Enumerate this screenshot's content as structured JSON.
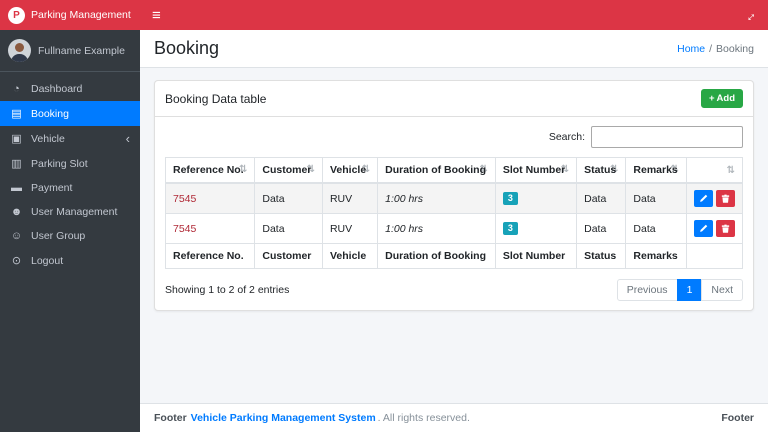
{
  "colors": {
    "red": "#dc3545",
    "sidebar_dark": "#343a40",
    "active_blue": "#007bff",
    "green": "#28a745",
    "teal_badge": "#17a2b8",
    "ref_red": "#b02a37"
  },
  "brand": {
    "title": "Parking Management",
    "logo_letter": "P"
  },
  "topbar": {
    "menu_icon": "≡",
    "fullscreen_icon": "↔"
  },
  "sidebar": {
    "user_name": "Fullname Example",
    "items": [
      {
        "label": "Dashboard",
        "icon": "◔"
      },
      {
        "label": "Booking",
        "icon": "▤"
      },
      {
        "label": "Vehicle",
        "icon": "▣",
        "chevron": "‹"
      },
      {
        "label": "Parking Slot",
        "icon": "▥"
      },
      {
        "label": "Payment",
        "icon": "▬"
      },
      {
        "label": "User Management",
        "icon": "☻"
      },
      {
        "label": "User Group",
        "icon": "☺"
      },
      {
        "label": "Logout",
        "icon": "⊙"
      }
    ]
  },
  "page": {
    "title": "Booking",
    "breadcrumb_home": "Home",
    "breadcrumb_sep": "/",
    "breadcrumb_current": "Booking"
  },
  "card": {
    "title": "Booking Data table",
    "add_icon": "+",
    "add_label": "Add"
  },
  "search": {
    "label": "Search:",
    "value": ""
  },
  "table": {
    "sort_icon": "⇅",
    "headers": [
      "Reference No.",
      "Customer",
      "Vehicle",
      "Duration of Booking",
      "Slot Number",
      "Status",
      "Remarks"
    ],
    "rows": [
      {
        "reference": "7545",
        "customer": "Data",
        "vehicle": "RUV",
        "duration": "1:00 hrs",
        "slot": "3",
        "status": "Data",
        "remarks": "Data"
      },
      {
        "reference": "7545",
        "customer": "Data",
        "vehicle": "RUV",
        "duration": "1:00 hrs",
        "slot": "3",
        "status": "Data",
        "remarks": "Data"
      }
    ],
    "footer_headers": [
      "Reference No.",
      "Customer",
      "Vehicle",
      "Duration of Booking",
      "Slot Number",
      "Status",
      "Remarks"
    ],
    "info": "Showing 1 to 2 of 2 entries"
  },
  "pagination": {
    "previous": "Previous",
    "current": "1",
    "next": "Next"
  },
  "footer": {
    "label": "Footer",
    "brand": "Vehicle Parking Management System",
    "rights": ". All rights reserved.",
    "right": "Footer"
  }
}
